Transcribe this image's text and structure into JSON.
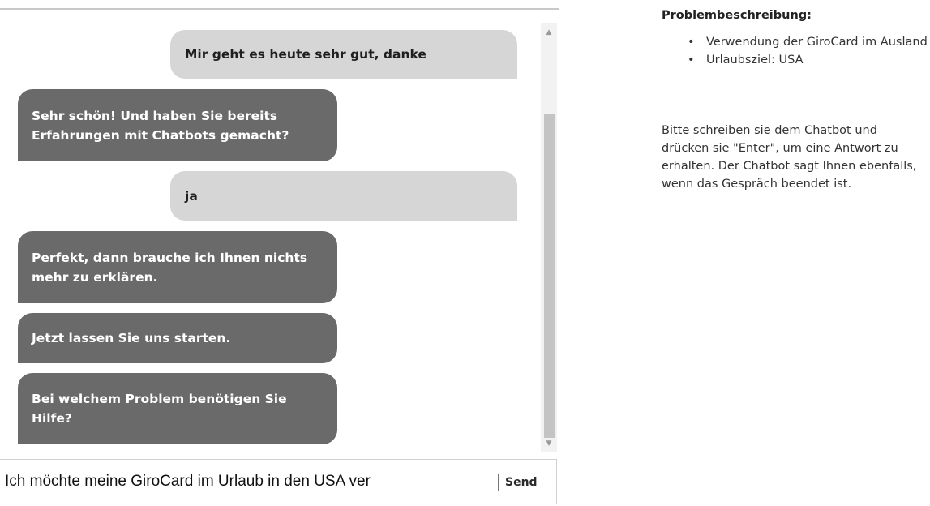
{
  "chat": {
    "messages": [
      {
        "sender": "user",
        "text": "Mir geht es heute sehr gut, danke"
      },
      {
        "sender": "bot",
        "text": "Sehr schön! Und haben Sie bereits Erfahrungen mit Chatbots gemacht?"
      },
      {
        "sender": "user",
        "text": "ja"
      },
      {
        "sender": "bot",
        "text": "Perfekt, dann brauche ich Ihnen nichts mehr zu erklären."
      },
      {
        "sender": "bot",
        "text": "Jetzt lassen Sie uns starten."
      },
      {
        "sender": "bot",
        "text": "Bei welchem Problem benötigen Sie Hilfe?"
      }
    ],
    "input_value": "Ich möchte meine GiroCard im Urlaub in den USA ver",
    "send_label": "Send",
    "scroll_up_glyph": "▲",
    "scroll_down_glyph": "▼"
  },
  "sidebar": {
    "title": "Problembeschreibung:",
    "bullet": "•",
    "items": [
      "Verwendung der GiroCard im Ausland",
      "Urlaubsziel: USA"
    ],
    "instructions": "Bitte schreiben sie dem Chatbot und drücken sie \"Enter\", um eine Antwort zu erhalten. Der Chatbot sagt Ihnen ebenfalls, wenn das Gespräch beendet ist."
  },
  "colors": {
    "bot_bubble": "#6a6a6a",
    "user_bubble": "#d6d6d6",
    "scroll_thumb": "#c4c4c4"
  }
}
